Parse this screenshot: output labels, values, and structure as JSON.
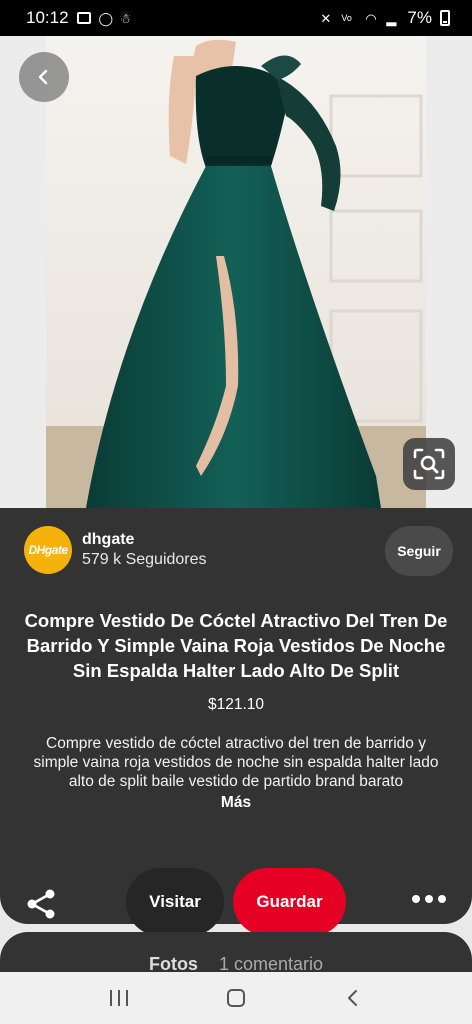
{
  "status_bar": {
    "time": "10:12",
    "battery": "7%"
  },
  "pin": {
    "pinner_name": "dhgate",
    "avatar_text": "DHgate",
    "followers": "579 k Seguidores",
    "follow_label": "Seguir",
    "title": "Compre Vestido De Cóctel Atractivo Del Tren De Barrido Y Simple Vaina Roja Vestidos De Noche Sin Espalda Halter Lado Alto De Split",
    "price": "$121.10",
    "description": "Compre vestido de cóctel atractivo del tren de barrido y simple vaina roja vestidos de noche sin espalda halter lado alto de split baile vestido de partido brand barato",
    "more_label": "Más"
  },
  "actions": {
    "visit_label": "Visitar",
    "save_label": "Guardar"
  },
  "comments_card": {
    "photos_tab": "Fotos",
    "comments_tab": "1 comentario"
  },
  "colors": {
    "accent": "#e60023",
    "card_bg": "#333333",
    "dress": "#0e4a44"
  },
  "icons": {
    "back": "chevron-left-icon",
    "lens": "visual-search-icon",
    "share": "share-icon",
    "more": "more-horizontal-icon"
  }
}
